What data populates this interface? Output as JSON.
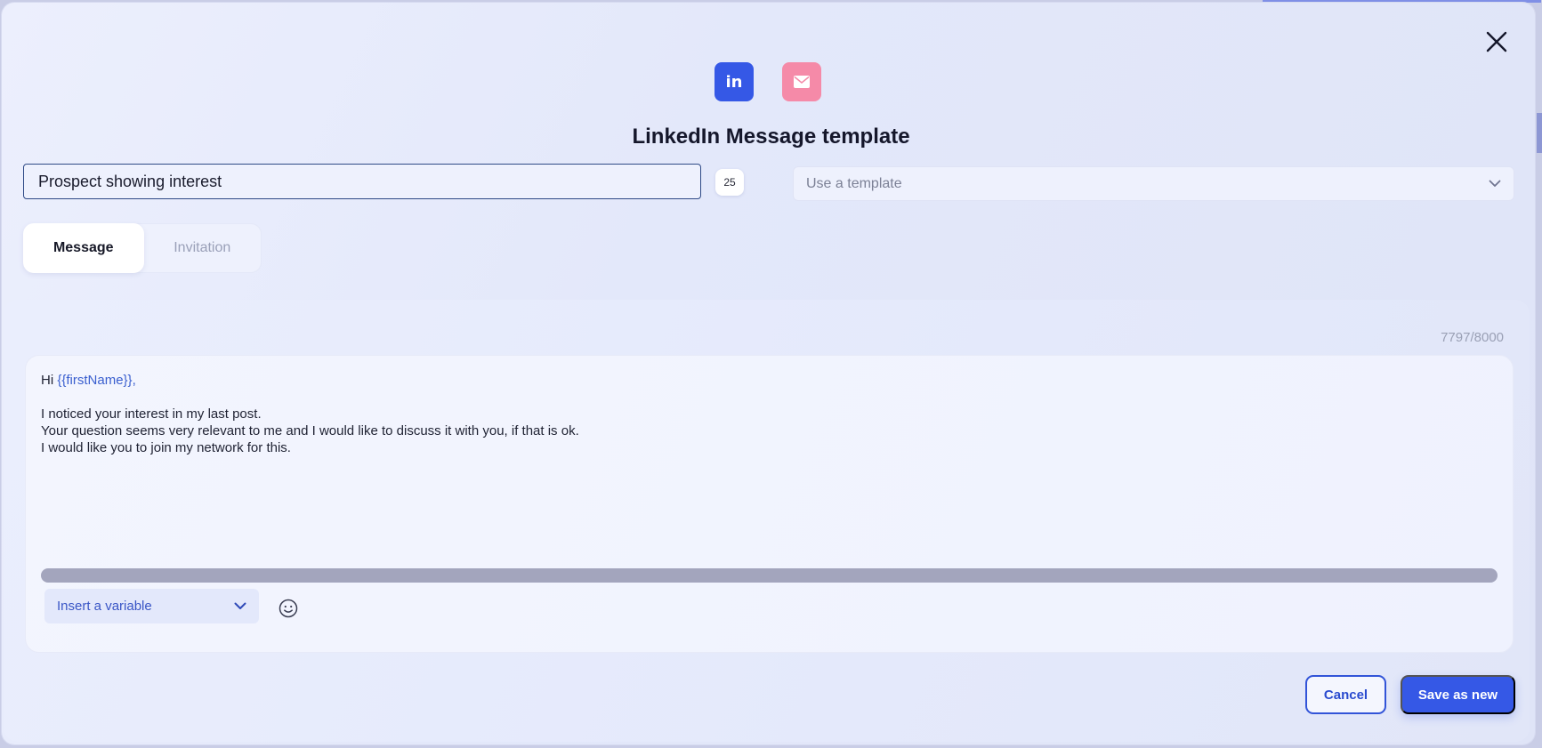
{
  "modal": {
    "title": "LinkedIn Message template",
    "close_icon": "close-icon"
  },
  "channels": [
    {
      "name": "linkedin",
      "icon": "linkedin-icon",
      "label": "in",
      "color": "#3558e6"
    },
    {
      "name": "email",
      "icon": "envelope-icon",
      "color": "#f58aa8"
    }
  ],
  "template_name": {
    "value": "Prospect showing interest",
    "char_count": "25"
  },
  "template_select": {
    "placeholder": "Use a template",
    "icon": "chevron-down-icon"
  },
  "tabs": [
    {
      "label": "Message",
      "active": true
    },
    {
      "label": "Invitation",
      "active": false
    }
  ],
  "editor": {
    "char_limit": "7797/8000",
    "greeting": "Hi ",
    "variable": "{{firstName}}",
    "greeting_end": ",",
    "lines": [
      "I noticed your interest in my last post.",
      "Your question seems very relevant to me and I would like to discuss it with you, if that is ok.",
      "I would like you to join my network for this."
    ],
    "insert_variable_label": "Insert a variable",
    "emoji_icon": "smiley-icon"
  },
  "actions": {
    "cancel_label": "Cancel",
    "save_label": "Save as new"
  },
  "colors": {
    "primary": "#3558e6",
    "email": "#f58aa8",
    "variable": "#3a5fcf"
  }
}
